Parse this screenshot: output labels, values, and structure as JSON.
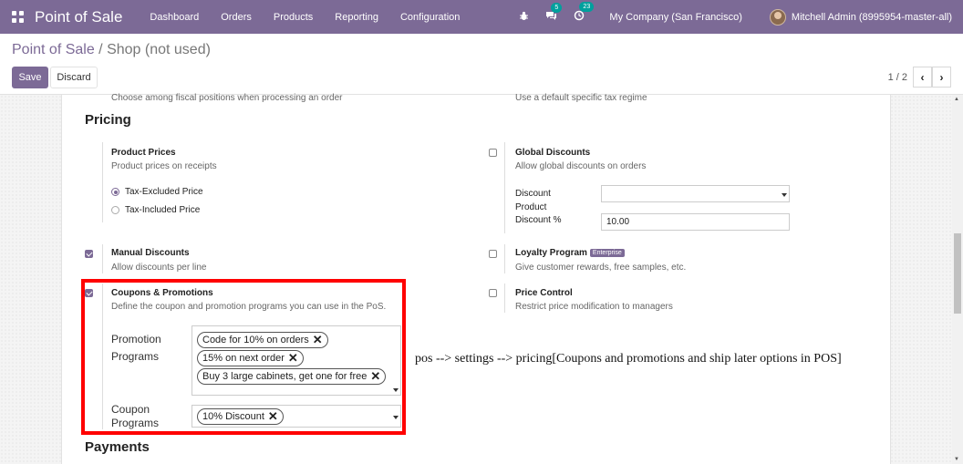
{
  "navbar": {
    "brand": "Point of Sale",
    "menu": [
      "Dashboard",
      "Orders",
      "Products",
      "Reporting",
      "Configuration"
    ],
    "messages_badge": "5",
    "activities_badge": "23",
    "company": "My Company (San Francisco)",
    "user": "Mitchell Admin (8995954-master-all)"
  },
  "control": {
    "breadcrumb_parent": "Point of Sale",
    "breadcrumb_sep": " / ",
    "breadcrumb_current": "Shop (not used)",
    "save_label": "Save",
    "discard_label": "Discard",
    "pager": "1 / 2"
  },
  "settings": {
    "fiscal_hint": "Choose among fiscal positions when processing an order",
    "tax_hint": "Use a default specific tax regime",
    "pricing_title": "Pricing",
    "payments_title": "Payments",
    "product_prices": {
      "title": "Product Prices",
      "desc": "Product prices on receipts",
      "options": [
        "Tax-Excluded Price",
        "Tax-Included Price"
      ],
      "selected": "Tax-Excluded Price"
    },
    "global_discounts": {
      "title": "Global Discounts",
      "desc": "Allow global discounts on orders",
      "discount_product_label": "Discount Product",
      "discount_product_value": "",
      "discount_pct_label": "Discount %",
      "discount_pct_value": "10.00",
      "checked": false
    },
    "manual_discounts": {
      "title": "Manual Discounts",
      "desc": "Allow discounts per line",
      "checked": true
    },
    "loyalty": {
      "title": "Loyalty Program",
      "badge": "Enterprise",
      "desc": "Give customer rewards, free samples, etc.",
      "checked": false
    },
    "coupons": {
      "title": "Coupons & Promotions",
      "desc": "Define the coupon and promotion programs you can use in the PoS.",
      "checked": true,
      "promotion_label": "Promotion Programs",
      "promotion_tags": [
        "Code for 10% on orders",
        "15% on next order",
        "Buy 3 large cabinets, get one for free"
      ],
      "coupon_label": "Coupon Programs",
      "coupon_tags": [
        "10% Discount"
      ]
    },
    "price_control": {
      "title": "Price Control",
      "desc": "Restrict price modification to managers",
      "checked": false
    }
  },
  "annotation": "pos --> settings --> pricing[Coupons and promotions and ship later options in POS]",
  "colors": {
    "brand": "#7c6a96",
    "highlight": "#ff0000",
    "badge": "#00a09d"
  },
  "icons": [
    "apps-icon",
    "bug-icon",
    "chat-icon",
    "clock-icon",
    "chevron-left-icon",
    "chevron-right-icon",
    "close-icon",
    "caret-down-icon"
  ]
}
